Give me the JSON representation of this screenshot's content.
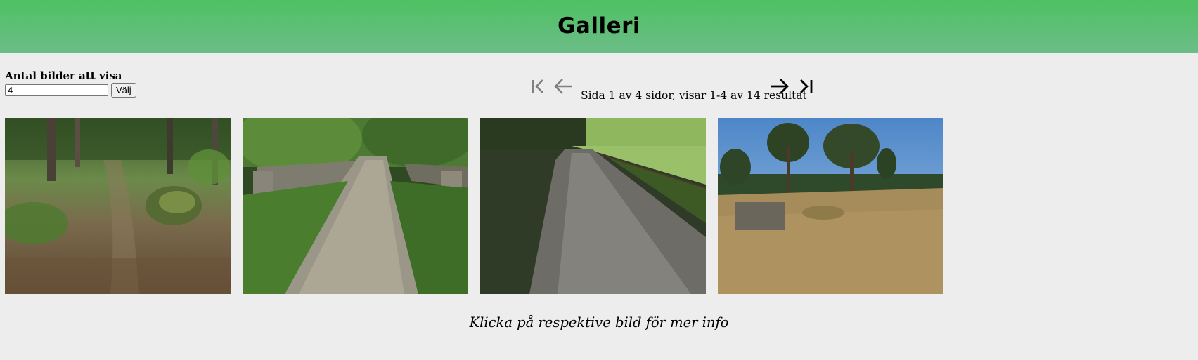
{
  "header": {
    "title": "Galleri"
  },
  "count_form": {
    "label": "Antal bilder att visa",
    "value": "4",
    "button_label": "Välj"
  },
  "pagination": {
    "info": "Sida 1 av 4 sidor, visar 1-4 av 14 resultat",
    "first_icon": "first-page-icon",
    "prev_icon": "arrow-left-icon",
    "next_icon": "arrow-right-icon",
    "last_icon": "last-page-icon"
  },
  "gallery": {
    "photos": [
      {
        "subject": "forest-path-photo"
      },
      {
        "subject": "gravel-road-stone-walls-photo"
      },
      {
        "subject": "gravel-road-meadow-photo"
      },
      {
        "subject": "field-with-pines-photo"
      }
    ]
  },
  "caption": "Klicka på respektive bild för mer info",
  "colors": {
    "header_top": "#4ec162",
    "header_bottom": "#6cbd88",
    "page_bg": "#ededed",
    "nav_disabled": "#808080",
    "nav_enabled": "#000000"
  }
}
